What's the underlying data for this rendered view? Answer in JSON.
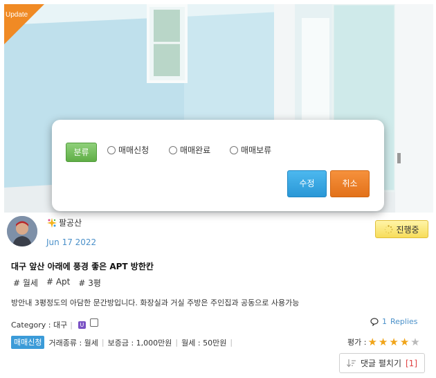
{
  "photo": {
    "ribbon_label": "Update"
  },
  "modal": {
    "category_label": "분류",
    "radio_options": [
      "매매신청",
      "매매완료",
      "매매보류"
    ],
    "edit_label": "수정",
    "cancel_label": "취소"
  },
  "post": {
    "author_name": "팔공산",
    "date": "Jun 17 2022",
    "status_label": "진행중",
    "title": "대구 앞산 아래에 풍경 좋은 APT 방한칸",
    "tags": [
      "# 월세",
      "# Apt",
      "# 3평"
    ],
    "description": "방안내 3평정도의 아담한 문간방입니다. 화장실과 거실 주방은 주인집과 공동으로 사용가능",
    "category_text": "Category : 대구",
    "replies_count": "1",
    "replies_label": "Replies",
    "trade_badge": "매매신청",
    "trade_type": "거래종류 : 월세",
    "deposit": "보증금 : 1,000만원",
    "monthly": "월세 : 50만원",
    "rating_label": "평가 :",
    "rating_stars": 4.5,
    "rating_max": 5,
    "comment_button_label": "댓글 펼치기",
    "comment_count": "[1]"
  },
  "icons": {
    "author_icon": "sparkle-icon",
    "status_icon": "spinner-icon",
    "replies_icon": "speech-bubble-icon",
    "comment_icon": "sort-down-icon",
    "category_badge_icon": "u-badge-icon"
  },
  "colors": {
    "ribbon": "#f08a24",
    "category_button": "#5fae46",
    "edit_button": "#2a97d6",
    "cancel_button": "#e2711a",
    "status_button": "#f7dd5a",
    "trade_badge": "#3b9bd8",
    "link": "#4a90c9",
    "star": "#f0a419"
  }
}
